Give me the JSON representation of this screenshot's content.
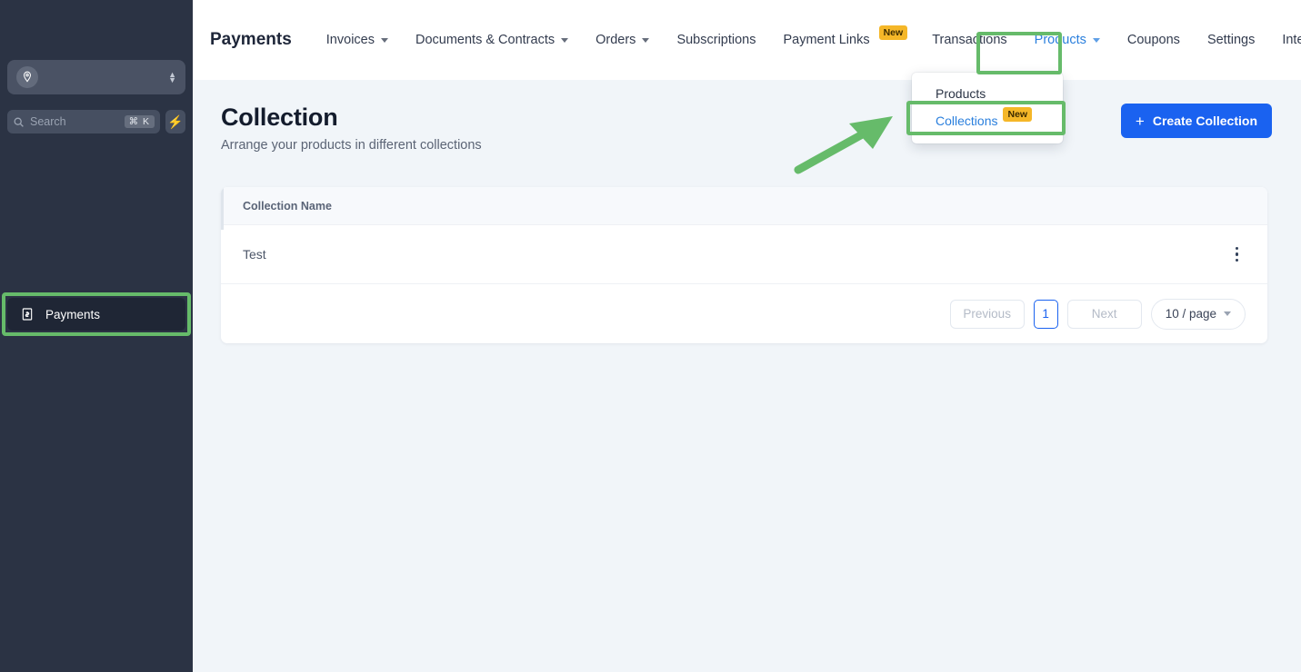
{
  "sidebar": {
    "workspace": {
      "icon": "workspace-pin-icon",
      "selector_icon": "updown-chevron-icon"
    },
    "search": {
      "placeholder": "Search",
      "shortcut": "⌘ K",
      "icon": "search-icon",
      "action_icon": "lightning-bolt-icon"
    },
    "items": [
      {
        "label": "Payments",
        "icon": "receipt-dollar-icon",
        "active": true,
        "highlighted": true
      }
    ]
  },
  "topnav": {
    "brand": "Payments",
    "links": [
      {
        "label": "Invoices",
        "has_dropdown": true
      },
      {
        "label": "Documents & Contracts",
        "has_dropdown": true
      },
      {
        "label": "Orders",
        "has_dropdown": true
      },
      {
        "label": "Subscriptions",
        "has_dropdown": false
      },
      {
        "label": "Payment Links",
        "has_dropdown": false,
        "badge": "New"
      },
      {
        "label": "Transactions",
        "has_dropdown": false
      },
      {
        "label": "Products",
        "has_dropdown": true,
        "active": true,
        "highlighted": true
      },
      {
        "label": "Coupons",
        "has_dropdown": false
      },
      {
        "label": "Settings",
        "has_dropdown": false
      },
      {
        "label": "Integrations",
        "has_dropdown": false
      }
    ]
  },
  "dropdown": {
    "items": [
      {
        "label": "Products",
        "active": false
      },
      {
        "label": "Collections",
        "active": true,
        "badge": "New",
        "highlighted": true
      }
    ]
  },
  "page": {
    "title": "Collection",
    "subtitle": "Arrange your products in different collections",
    "create_button": {
      "label": "Create Collection",
      "icon": "plus-icon"
    }
  },
  "table": {
    "columns": [
      "Collection Name"
    ],
    "rows": [
      {
        "name": "Test",
        "menu_icon": "kebab-menu-icon"
      }
    ]
  },
  "pagination": {
    "previous": "Previous",
    "next": "Next",
    "current_page": "1",
    "page_size": "10 / page"
  },
  "annotations": {
    "arrow": {
      "color": "#66bb6a",
      "points_to": "collections-menu-item"
    },
    "highlight_color": "#66bb6a"
  },
  "colors": {
    "sidebar_bg": "#2b3344",
    "accent_blue": "#1a62f0",
    "link_blue": "#2a7fdd",
    "badge_amber": "#f5b728",
    "page_bg": "#f1f5f9",
    "highlight_green": "#66bb6a"
  }
}
